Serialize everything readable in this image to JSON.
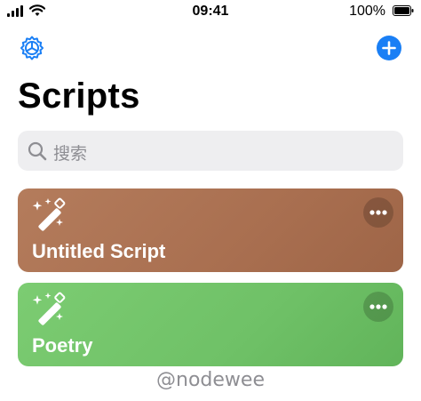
{
  "status_bar": {
    "time": "09:41",
    "battery_percent": "100%",
    "signal_icon": "cellular-signal-icon",
    "wifi_icon": "wifi-icon",
    "battery_icon": "battery-icon"
  },
  "nav": {
    "settings_icon": "gear-icon",
    "add_icon": "plus-icon"
  },
  "header": {
    "title": "Scripts"
  },
  "search": {
    "placeholder": "搜索",
    "icon": "search-icon"
  },
  "scripts": [
    {
      "name": "Untitled Script",
      "icon": "magic-wand-icon",
      "color": "#ad7455"
    },
    {
      "name": "Poetry",
      "icon": "magic-wand-icon",
      "color": "#6ec266"
    }
  ],
  "watermark": {
    "text": "@nodewee"
  },
  "colors": {
    "accent": "#1a7ff5",
    "search_bg": "#eeeef0",
    "placeholder": "#8e8e93"
  }
}
